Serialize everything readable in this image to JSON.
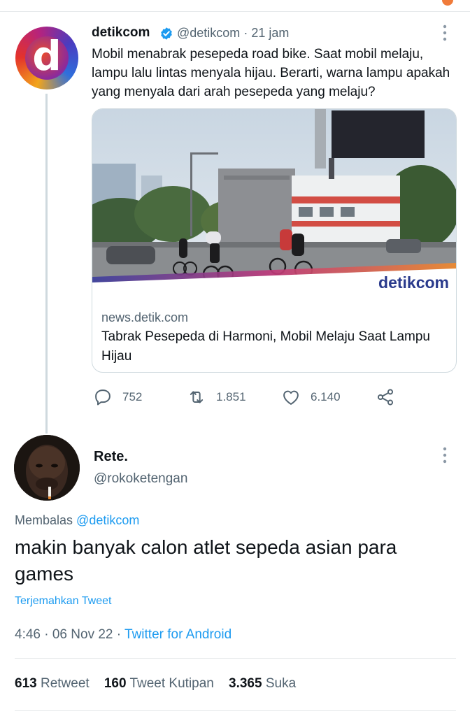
{
  "tweet": {
    "author_name": "detikcom",
    "author_handle": "@detikcom",
    "time": "· 21 jam",
    "text": "Mobil menabrak pesepeda road bike. Saat mobil melaju, lampu lalu lintas menyala hijau. Berarti, warna lampu apakah yang menyala dari arah pesepeda yang melaju?",
    "card": {
      "watermark": "detikcom",
      "domain": "news.detik.com",
      "title": "Tabrak Pesepeda di Harmoni, Mobil Melaju Saat Lampu Hijau"
    },
    "actions": {
      "reply_count": "752",
      "retweet_count": "1.851",
      "like_count": "6.140"
    }
  },
  "reply": {
    "author_name": "Rete.",
    "author_handle": "@rokoketengan",
    "replying_prefix": "Membalas",
    "replying_to": "@detikcom",
    "text": "makin banyak calon atlet sepeda asian para games",
    "translate_label": "Terjemahkan Tweet",
    "timestamp": "4:46 · 06 Nov 22 ·",
    "source": "Twitter for Android",
    "stats": {
      "retweets": "613",
      "retweets_label": "Retweet",
      "quotes": "160",
      "quotes_label": "Tweet Kutipan",
      "likes": "3.365",
      "likes_label": "Suka"
    }
  },
  "colors": {
    "accent": "#1d9bf0",
    "secondary_text": "#536471",
    "border": "#cfd9de"
  }
}
